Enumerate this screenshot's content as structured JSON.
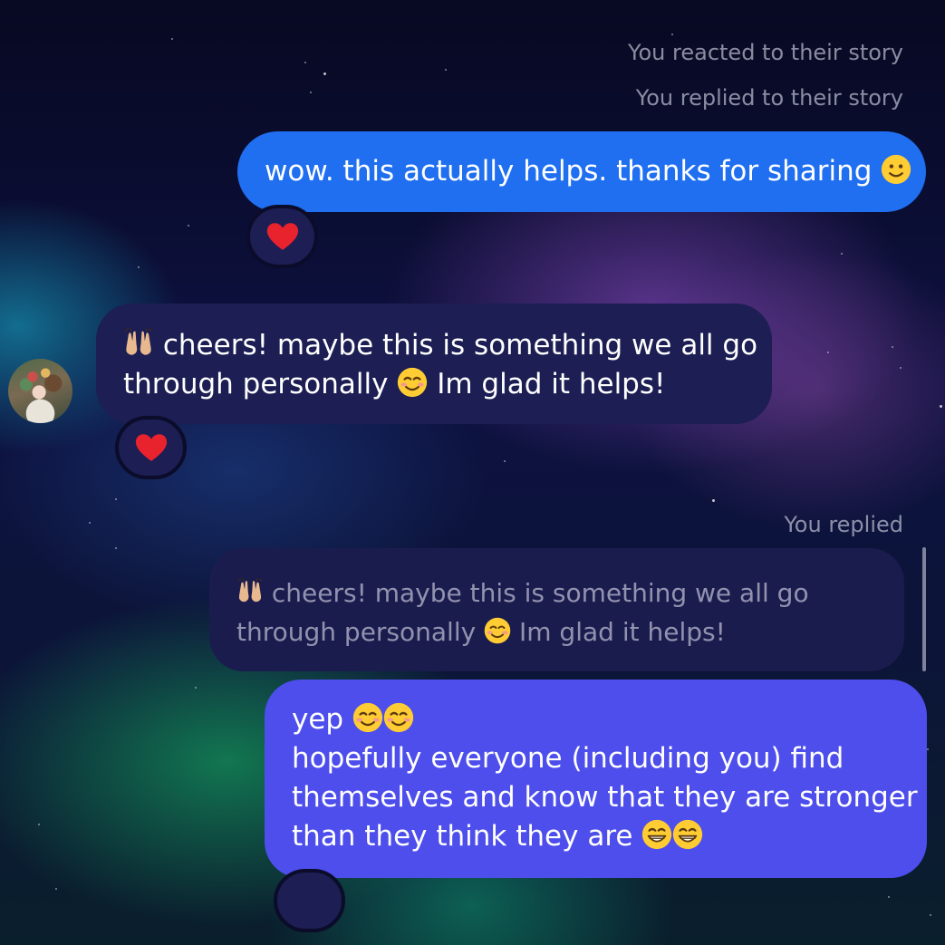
{
  "chat": {
    "meta_reacted": "You reacted to their story",
    "meta_replied_story": "You replied to their story",
    "meta_you_replied": "You replied",
    "message_1": {
      "text": "wow.  this actually helps. thanks for sharing",
      "emoji": "slightly-smiling-face",
      "reaction": "red-heart"
    },
    "message_2": {
      "line1": "cheers! maybe this is something we all go",
      "line2_a": "through personally",
      "line2_b": "Im glad it helps!",
      "reaction": "red-heart"
    },
    "quoted_reply": {
      "line1": "cheers! maybe this is something we all go",
      "line2_a": "through personally",
      "line2_b": "Im glad it helps!"
    },
    "message_3": {
      "line1": "yep",
      "line2": "hopefully everyone (including you) find",
      "line3": "themselves and know that they are stronger",
      "line4": "than they think they are"
    }
  },
  "colors": {
    "outgoing_bubble": "#1f6ff0",
    "incoming_bubble": "#1c1e54",
    "latest_bubble": "#4d4eeb",
    "meta_text": "#c8c8dc"
  },
  "icons": {
    "raising_hands": "raising-hands-icon",
    "smiling_face": "smiling-face-icon",
    "heart": "heart-icon",
    "grinning_face": "grinning-face-icon"
  }
}
